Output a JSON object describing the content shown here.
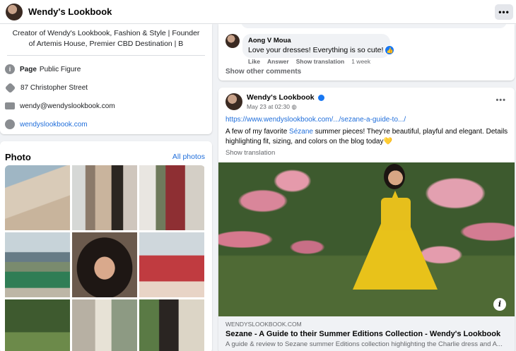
{
  "header": {
    "page_name": "Wendy's Lookbook",
    "more_label": "•••"
  },
  "intro": {
    "bio": "Creator of Wendy's Lookbook, Fashion & Style | Founder of Artemis House, Premier CBD Destination | B",
    "items": [
      {
        "icon": "info-icon",
        "bold": "Page",
        "text": "Public Figure"
      },
      {
        "icon": "location-pin-icon",
        "bold": "",
        "text": "87 Christopher Street"
      },
      {
        "icon": "email-icon",
        "bold": "",
        "text": "wendy@wendyslookbook.com"
      },
      {
        "icon": "globe-icon",
        "bold": "",
        "text": "wendyslookbook.com"
      }
    ]
  },
  "photos": {
    "title": "Photo",
    "all_label": "All photos"
  },
  "comment": {
    "author": "Aong V Moua",
    "text": "Love your dresses! Everything is so cute!",
    "actions": {
      "like": "Like",
      "answer": "Answer",
      "translate": "Show translation",
      "time": "1 week"
    },
    "show_more": "Show other comments"
  },
  "post": {
    "author": "Wendy's Lookbook",
    "date": "May 23 at 02:30",
    "more_label": "•••",
    "url": "https://www.wendyslookbook.com/.../sezane-a-guide-to.../",
    "text_before": "A few of my favorite ",
    "text_link": "Sézane",
    "text_after": " summer pieces! They're beautiful, playful and elegant. Details highlighting fit, sizing, and colors on the blog today💛",
    "show_translation": "Show translation",
    "info_label": "i",
    "link_preview": {
      "domain": "WENDYSLOOKBOOK.COM",
      "title": "Sezane - A Guide to their Summer Editions Collection - Wendy's Lookbook",
      "description": "A guide & review to Sezane summer Editions collection highlighting the Charlie dress and A..."
    }
  },
  "colors": {
    "accent": "#216fdb",
    "verified": "#1877f2",
    "background": "#f0f2f5"
  }
}
